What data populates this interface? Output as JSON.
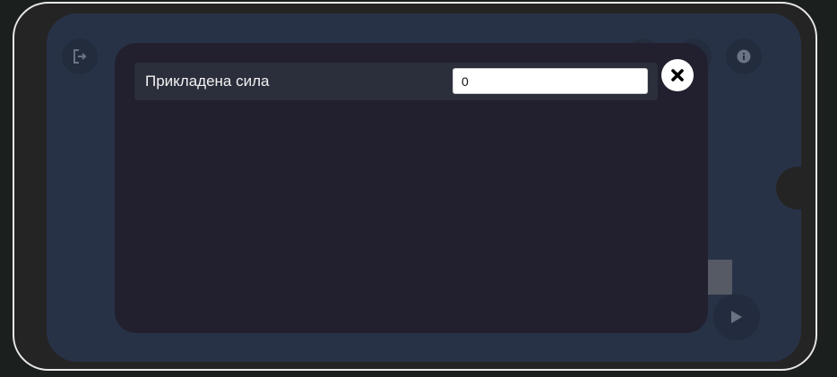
{
  "app": {
    "colors": {
      "screen_bg": "#283247",
      "modal_bg": "#22202e",
      "row_bg": "#2b2e3b",
      "icon_color": "#6a7283"
    }
  },
  "toolbar": {
    "exit_icon": "exit-icon",
    "info_icon": "info-icon",
    "play_icon": "play-icon"
  },
  "modal": {
    "fields": [
      {
        "label": "Прикладена сила",
        "value": "0"
      }
    ],
    "close_icon": "close-icon"
  }
}
